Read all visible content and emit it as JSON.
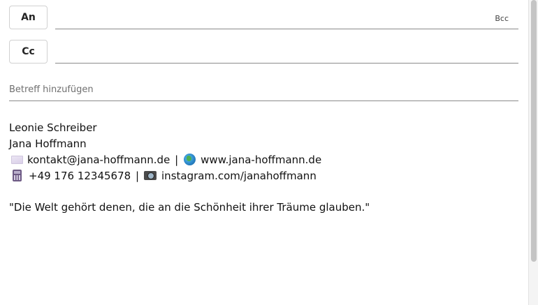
{
  "recipients": {
    "to_label": "An",
    "cc_label": "Cc",
    "bcc_label": "Bcc",
    "to_value": "",
    "cc_value": ""
  },
  "subject": {
    "placeholder": "Betreff hinzufügen",
    "value": ""
  },
  "signature": {
    "name_line_1": "Leonie Schreiber",
    "name_line_2": "Jana Hoffmann",
    "email": "kontakt@jana-hoffmann.de",
    "separator": "|",
    "website": "www.jana-hoffmann.de",
    "phone": "+49 176 12345678",
    "instagram": "instagram.com/janahoffmann",
    "quote": "\"Die Welt gehört denen, die an die Schönheit ihrer Träume glauben.\""
  },
  "icons": {
    "email": "envelope-icon",
    "website": "globe-icon",
    "phone": "mobile-phone-icon",
    "instagram": "camera-icon"
  }
}
